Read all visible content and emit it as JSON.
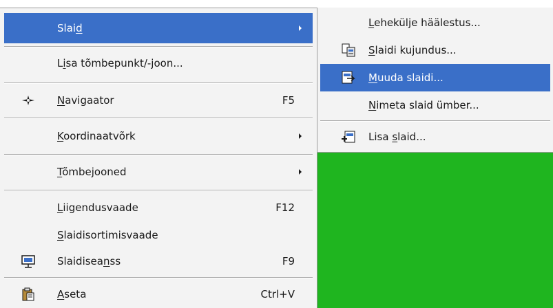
{
  "main_menu": {
    "items": [
      {
        "pre": "Slai",
        "u": "d",
        "post": "",
        "shortcut": ""
      },
      {
        "pre": "L",
        "u": "i",
        "post": "sa tõmbepunkt/-joon...",
        "shortcut": ""
      },
      {
        "pre": "",
        "u": "N",
        "post": "avigaator",
        "shortcut": "F5"
      },
      {
        "pre": "",
        "u": "K",
        "post": "oordinaatvõrk",
        "shortcut": ""
      },
      {
        "pre": "",
        "u": "T",
        "post": "õmbejooned",
        "shortcut": ""
      },
      {
        "pre": "",
        "u": "L",
        "post": "iigendusvaade",
        "shortcut": "F12"
      },
      {
        "pre": "",
        "u": "S",
        "post": "laidisortimisvaade",
        "shortcut": ""
      },
      {
        "pre": "Slaidisea",
        "u": "n",
        "post": "ss",
        "shortcut": "F9"
      },
      {
        "pre": "",
        "u": "A",
        "post": "seta",
        "shortcut": "Ctrl+V"
      }
    ]
  },
  "sub_menu": {
    "items": [
      {
        "pre": "",
        "u": "L",
        "post": "ehekülje häälestus..."
      },
      {
        "pre": "",
        "u": "S",
        "post": "laidi kujundus..."
      },
      {
        "pre": "",
        "u": "M",
        "post": "uuda slaidi..."
      },
      {
        "pre": "",
        "u": "N",
        "post": "imeta slaid ümber..."
      },
      {
        "pre": "Lisa ",
        "u": "s",
        "post": "laid..."
      }
    ]
  },
  "icons": {
    "navigator": "navigator-icon",
    "slideshow": "slideshow-icon",
    "paste": "paste-icon",
    "slide_design": "slide-design-icon",
    "modify_slide": "modify-slide-icon",
    "insert_slide": "insert-slide-icon"
  },
  "colors": {
    "highlight": "#3a6fc8",
    "menu_background": "#f3f3f3",
    "desktop_background": "#1fb51f"
  }
}
